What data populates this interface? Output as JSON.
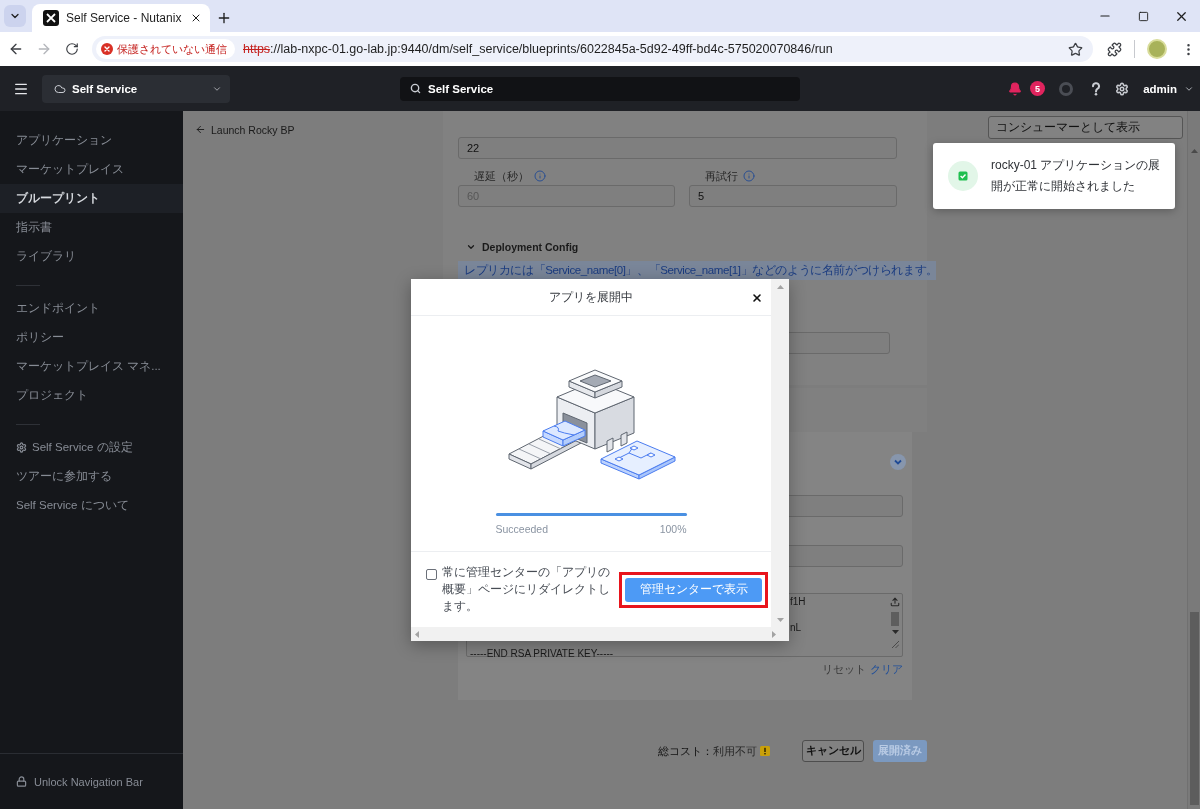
{
  "browser": {
    "tab": {
      "title": "Self Service - Nutanix",
      "selected": true
    },
    "forward": {
      "disabled": true
    },
    "security_chip": "保護されていない通信",
    "url": {
      "scheme": "https",
      "rest": "://lab-nxpc-01.go-lab.jp:9440/dm/self_service/blueprints/6022845a-5d92-49ff-bd4c-575020070846/run"
    }
  },
  "header": {
    "product": "Self Service",
    "search": {
      "value": "Self Service"
    },
    "notification_count": "5",
    "user": "admin"
  },
  "sidebar": {
    "groups": [
      {
        "items": [
          {
            "label": "アプリケーション",
            "selected": false
          },
          {
            "label": "マーケットプレイス",
            "selected": false
          },
          {
            "label": "ブループリント",
            "selected": true
          },
          {
            "label": "指示書",
            "selected": false
          },
          {
            "label": "ライブラリ",
            "selected": false
          }
        ]
      },
      {
        "items": [
          {
            "label": "エンドポイント",
            "selected": false
          },
          {
            "label": "ポリシー",
            "selected": false
          },
          {
            "label": "マーケットプレイス マネ...",
            "selected": false
          },
          {
            "label": "プロジェクト",
            "selected": false
          }
        ]
      },
      {
        "items": [
          {
            "kind": "settings",
            "label": "Self Service の設定",
            "selected": false
          },
          {
            "kind": "link",
            "label": "ツアーに参加する",
            "selected": false
          },
          {
            "kind": "link",
            "label": "Self Service について",
            "selected": false
          }
        ]
      }
    ],
    "footer": "Unlock Navigation Bar"
  },
  "page": {
    "breadcrumb": "Launch Rocky BP",
    "consumer_button": "コンシューマーとして表示"
  },
  "form": {
    "top_field": {
      "value": "22"
    },
    "delay": {
      "label": "遅延（秒）",
      "value": "60",
      "disabled": true
    },
    "retry": {
      "label": "再試行",
      "value": "5",
      "disabled": false
    },
    "section": {
      "title": "Deployment Config",
      "expanded": true
    },
    "info_banner": "レプリカには「Service_name[0]」、「Service_name[1]」などのように名前がつけられます。",
    "key_lines": [
      {
        "kind": "tail",
        "text": "f1H"
      },
      {
        "kind": "tail",
        "text": "nL"
      },
      {
        "kind": "full",
        "text": "-----END RSA PRIVATE KEY-----"
      }
    ],
    "reset": "リセット",
    "clear": "クリア"
  },
  "footer": {
    "cost_label": "総コスト：",
    "cost_value": "利用不可",
    "cancel": "キャンセル",
    "deploy": {
      "label": "展開済み",
      "disabled": true
    }
  },
  "modal": {
    "title": "アプリを展開中",
    "progress": {
      "level": 1,
      "status": "Succeeded",
      "percent": "100%"
    },
    "redirect": {
      "label": "常に管理センターの「アプリの概要」ページにリダイレクトします。",
      "checked": false
    },
    "primary_button": "管理センターで表示"
  },
  "toast": {
    "message": "rocky-01 アプリケーションの展開が正常に開始されました"
  }
}
